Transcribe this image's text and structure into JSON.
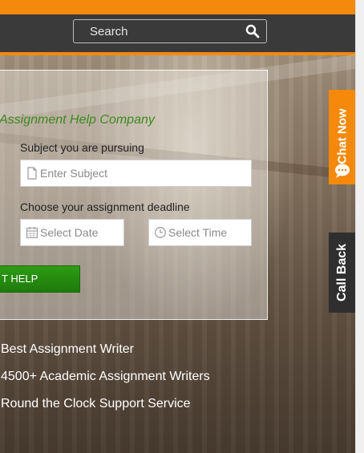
{
  "header": {
    "search": {
      "placeholder": "Search"
    }
  },
  "form": {
    "title": "Assignment Help Company",
    "subject_label": "Subject you are pursuing",
    "subject_placeholder": "Enter Subject",
    "deadline_label": "Choose your assignment deadline",
    "date_placeholder": "Select Date",
    "time_placeholder": "Select Time",
    "submit_label": "T HELP"
  },
  "features": [
    "Best Assignment Writer",
    "4500+ Academic Assignment Writers",
    "Round the Clock Support Service"
  ],
  "side_tabs": {
    "chat": "Chat Now",
    "call": "Call Back"
  },
  "colors": {
    "accent": "#f4890b",
    "nav": "#3a3a3a",
    "button": "#2e9c14",
    "title": "#3c8a1c"
  }
}
